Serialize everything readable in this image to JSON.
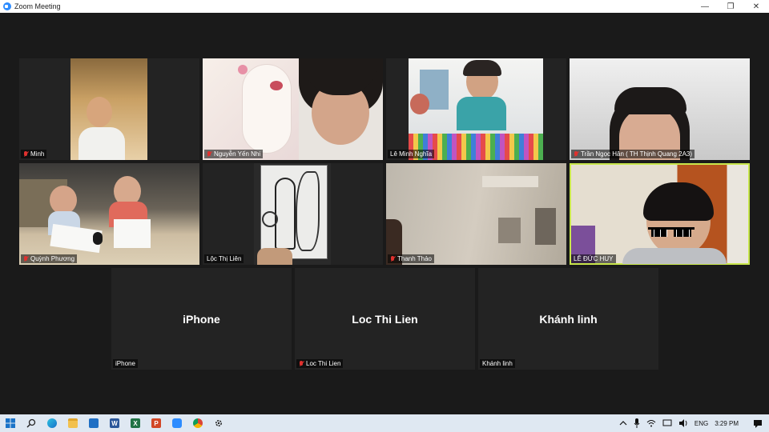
{
  "window": {
    "title": "Zoom Meeting",
    "minimize": "—",
    "restore": "❐",
    "close": "✕"
  },
  "participants": [
    {
      "name": "Minh",
      "muted": true
    },
    {
      "name": "Nguyễn Yến Nhi",
      "muted": true
    },
    {
      "name": "Lê Minh Nghĩa",
      "muted": false
    },
    {
      "name": "Trần Ngọc Hân ( TH Thịnh Quang 2A3)",
      "muted": true
    },
    {
      "name": "Quỳnh Phương",
      "muted": true
    },
    {
      "name": "Lộc Thị Liên",
      "muted": false
    },
    {
      "name": "Thanh Thảo",
      "muted": true
    },
    {
      "name": "LÊ ĐỨC HUY",
      "muted": false,
      "active_speaker": true
    },
    {
      "name": "iPhone",
      "display_name": "iPhone",
      "muted": false
    },
    {
      "name": "Loc Thi Lien",
      "display_name": "Loc Thi Lien",
      "muted": true
    },
    {
      "name": "Khánh linh",
      "display_name": "Khánh linh",
      "muted": false
    }
  ],
  "taskbar": {
    "apps": [
      "start-icon",
      "search-icon",
      "edge-icon",
      "file-explorer-icon",
      "mail-icon",
      "word-icon",
      "excel-icon",
      "powerpoint-icon",
      "zoom-icon",
      "chrome-icon",
      "settings-icon"
    ],
    "language": "ENG",
    "time": "3:29 PM"
  },
  "colors": {
    "active_border": "#c8e64b",
    "muted_mic": "#e0312e",
    "zoom_blue": "#2d8cff"
  }
}
